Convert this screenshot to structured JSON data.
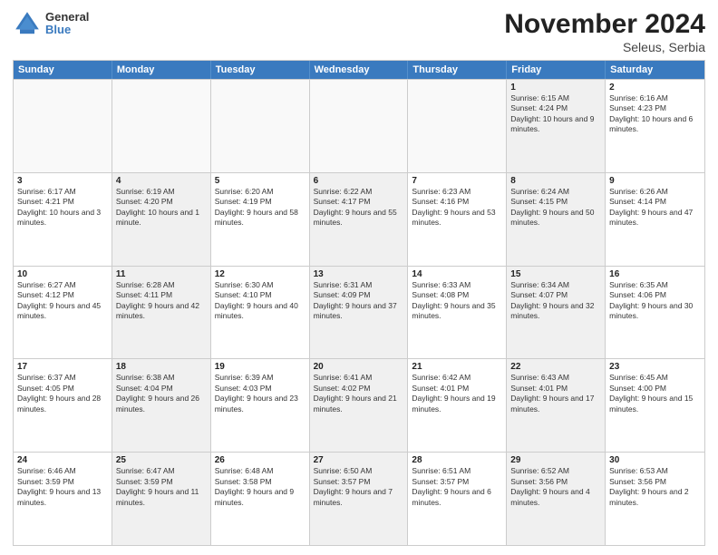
{
  "header": {
    "logo_general": "General",
    "logo_blue": "Blue",
    "month_year": "November 2024",
    "location": "Seleus, Serbia"
  },
  "days_of_week": [
    "Sunday",
    "Monday",
    "Tuesday",
    "Wednesday",
    "Thursday",
    "Friday",
    "Saturday"
  ],
  "rows": [
    [
      {
        "day": "",
        "info": "",
        "empty": true
      },
      {
        "day": "",
        "info": "",
        "empty": true
      },
      {
        "day": "",
        "info": "",
        "empty": true
      },
      {
        "day": "",
        "info": "",
        "empty": true
      },
      {
        "day": "",
        "info": "",
        "empty": true
      },
      {
        "day": "1",
        "info": "Sunrise: 6:15 AM\nSunset: 4:24 PM\nDaylight: 10 hours and 9 minutes.",
        "shaded": true
      },
      {
        "day": "2",
        "info": "Sunrise: 6:16 AM\nSunset: 4:23 PM\nDaylight: 10 hours and 6 minutes.",
        "shaded": false
      }
    ],
    [
      {
        "day": "3",
        "info": "Sunrise: 6:17 AM\nSunset: 4:21 PM\nDaylight: 10 hours and 3 minutes.",
        "shaded": false
      },
      {
        "day": "4",
        "info": "Sunrise: 6:19 AM\nSunset: 4:20 PM\nDaylight: 10 hours and 1 minute.",
        "shaded": true
      },
      {
        "day": "5",
        "info": "Sunrise: 6:20 AM\nSunset: 4:19 PM\nDaylight: 9 hours and 58 minutes.",
        "shaded": false
      },
      {
        "day": "6",
        "info": "Sunrise: 6:22 AM\nSunset: 4:17 PM\nDaylight: 9 hours and 55 minutes.",
        "shaded": true
      },
      {
        "day": "7",
        "info": "Sunrise: 6:23 AM\nSunset: 4:16 PM\nDaylight: 9 hours and 53 minutes.",
        "shaded": false
      },
      {
        "day": "8",
        "info": "Sunrise: 6:24 AM\nSunset: 4:15 PM\nDaylight: 9 hours and 50 minutes.",
        "shaded": true
      },
      {
        "day": "9",
        "info": "Sunrise: 6:26 AM\nSunset: 4:14 PM\nDaylight: 9 hours and 47 minutes.",
        "shaded": false
      }
    ],
    [
      {
        "day": "10",
        "info": "Sunrise: 6:27 AM\nSunset: 4:12 PM\nDaylight: 9 hours and 45 minutes.",
        "shaded": false
      },
      {
        "day": "11",
        "info": "Sunrise: 6:28 AM\nSunset: 4:11 PM\nDaylight: 9 hours and 42 minutes.",
        "shaded": true
      },
      {
        "day": "12",
        "info": "Sunrise: 6:30 AM\nSunset: 4:10 PM\nDaylight: 9 hours and 40 minutes.",
        "shaded": false
      },
      {
        "day": "13",
        "info": "Sunrise: 6:31 AM\nSunset: 4:09 PM\nDaylight: 9 hours and 37 minutes.",
        "shaded": true
      },
      {
        "day": "14",
        "info": "Sunrise: 6:33 AM\nSunset: 4:08 PM\nDaylight: 9 hours and 35 minutes.",
        "shaded": false
      },
      {
        "day": "15",
        "info": "Sunrise: 6:34 AM\nSunset: 4:07 PM\nDaylight: 9 hours and 32 minutes.",
        "shaded": true
      },
      {
        "day": "16",
        "info": "Sunrise: 6:35 AM\nSunset: 4:06 PM\nDaylight: 9 hours and 30 minutes.",
        "shaded": false
      }
    ],
    [
      {
        "day": "17",
        "info": "Sunrise: 6:37 AM\nSunset: 4:05 PM\nDaylight: 9 hours and 28 minutes.",
        "shaded": false
      },
      {
        "day": "18",
        "info": "Sunrise: 6:38 AM\nSunset: 4:04 PM\nDaylight: 9 hours and 26 minutes.",
        "shaded": true
      },
      {
        "day": "19",
        "info": "Sunrise: 6:39 AM\nSunset: 4:03 PM\nDaylight: 9 hours and 23 minutes.",
        "shaded": false
      },
      {
        "day": "20",
        "info": "Sunrise: 6:41 AM\nSunset: 4:02 PM\nDaylight: 9 hours and 21 minutes.",
        "shaded": true
      },
      {
        "day": "21",
        "info": "Sunrise: 6:42 AM\nSunset: 4:01 PM\nDaylight: 9 hours and 19 minutes.",
        "shaded": false
      },
      {
        "day": "22",
        "info": "Sunrise: 6:43 AM\nSunset: 4:01 PM\nDaylight: 9 hours and 17 minutes.",
        "shaded": true
      },
      {
        "day": "23",
        "info": "Sunrise: 6:45 AM\nSunset: 4:00 PM\nDaylight: 9 hours and 15 minutes.",
        "shaded": false
      }
    ],
    [
      {
        "day": "24",
        "info": "Sunrise: 6:46 AM\nSunset: 3:59 PM\nDaylight: 9 hours and 13 minutes.",
        "shaded": false
      },
      {
        "day": "25",
        "info": "Sunrise: 6:47 AM\nSunset: 3:59 PM\nDaylight: 9 hours and 11 minutes.",
        "shaded": true
      },
      {
        "day": "26",
        "info": "Sunrise: 6:48 AM\nSunset: 3:58 PM\nDaylight: 9 hours and 9 minutes.",
        "shaded": false
      },
      {
        "day": "27",
        "info": "Sunrise: 6:50 AM\nSunset: 3:57 PM\nDaylight: 9 hours and 7 minutes.",
        "shaded": true
      },
      {
        "day": "28",
        "info": "Sunrise: 6:51 AM\nSunset: 3:57 PM\nDaylight: 9 hours and 6 minutes.",
        "shaded": false
      },
      {
        "day": "29",
        "info": "Sunrise: 6:52 AM\nSunset: 3:56 PM\nDaylight: 9 hours and 4 minutes.",
        "shaded": true
      },
      {
        "day": "30",
        "info": "Sunrise: 6:53 AM\nSunset: 3:56 PM\nDaylight: 9 hours and 2 minutes.",
        "shaded": false
      }
    ]
  ]
}
